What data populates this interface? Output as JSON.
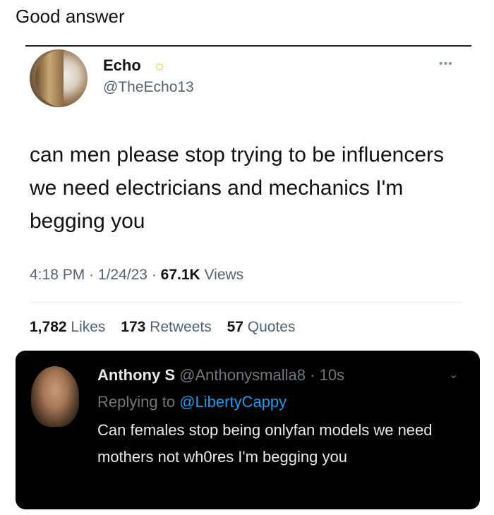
{
  "post_caption": "Good answer",
  "tweet": {
    "author_name": "Echo",
    "author_handle": "@TheEcho13",
    "text": "can men please stop trying to be influencers we need electricians and mechanics I'm begging you",
    "time": "4:18 PM",
    "date": "1/24/23",
    "views_count": "67.1K",
    "views_label": "Views",
    "likes_count": "1,782",
    "likes_label": "Likes",
    "retweets_count": "173",
    "retweets_label": "Retweets",
    "quotes_count": "57",
    "quotes_label": "Quotes",
    "badge_icon": "sun-icon",
    "more_icon": "more-icon"
  },
  "reply": {
    "author_name": "Anthony S",
    "author_handle": "@Anthonysmalla8",
    "time_ago": "10s",
    "replying_prefix": "Replying to",
    "replying_mention": "@LibertyCappy",
    "text": "Can females stop being onlyfan models we need mothers not wh0res I'm begging you",
    "menu_icon": "chevron-down-icon"
  },
  "colors": {
    "accent_blue": "#1d9bf0",
    "muted_gray": "#536471",
    "dark_bg": "#000000"
  }
}
